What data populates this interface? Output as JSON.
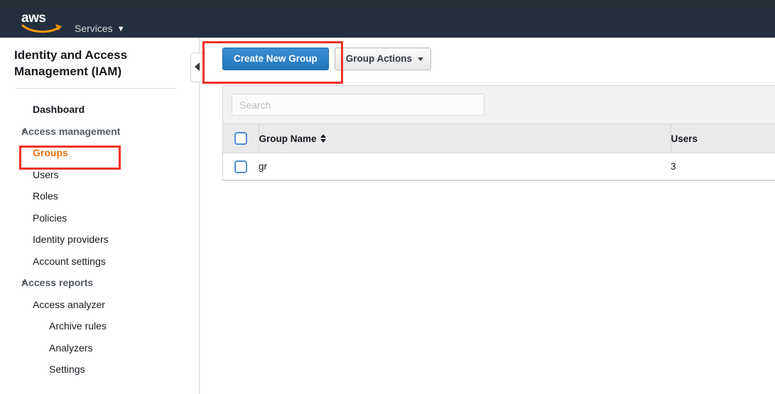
{
  "header": {
    "logo_text": "aws",
    "services_label": "Services",
    "services_caret": "▼"
  },
  "sidebar": {
    "title": "Identity and Access Management (IAM)",
    "items": [
      {
        "label": "Dashboard",
        "level": 0,
        "type": "link",
        "active": false
      },
      {
        "label": "Access management",
        "level": 0,
        "type": "group",
        "active": false
      },
      {
        "label": "Groups",
        "level": 1,
        "type": "link",
        "active": true
      },
      {
        "label": "Users",
        "level": 1,
        "type": "link",
        "active": false
      },
      {
        "label": "Roles",
        "level": 1,
        "type": "link",
        "active": false
      },
      {
        "label": "Policies",
        "level": 1,
        "type": "link",
        "active": false
      },
      {
        "label": "Identity providers",
        "level": 1,
        "type": "link",
        "active": false
      },
      {
        "label": "Account settings",
        "level": 1,
        "type": "link",
        "active": false
      },
      {
        "label": "Access reports",
        "level": 0,
        "type": "group",
        "active": false
      },
      {
        "label": "Access analyzer",
        "level": 1,
        "type": "link",
        "active": false
      },
      {
        "label": "Archive rules",
        "level": 2,
        "type": "link",
        "active": false
      },
      {
        "label": "Analyzers",
        "level": 2,
        "type": "link",
        "active": false
      },
      {
        "label": "Settings",
        "level": 2,
        "type": "link",
        "active": false
      }
    ],
    "expand_triangle": "▼"
  },
  "toolbar": {
    "create_label": "Create New Group",
    "actions_label": "Group Actions"
  },
  "search": {
    "placeholder": "Search",
    "value": ""
  },
  "table": {
    "columns": [
      "Group Name",
      "Users"
    ],
    "rows": [
      {
        "name": "gr",
        "users": "3"
      }
    ]
  },
  "annotations": {
    "accent_color": "#f03228",
    "highlight_color": "#ec7211",
    "primary_button_color": "#2176bd"
  }
}
